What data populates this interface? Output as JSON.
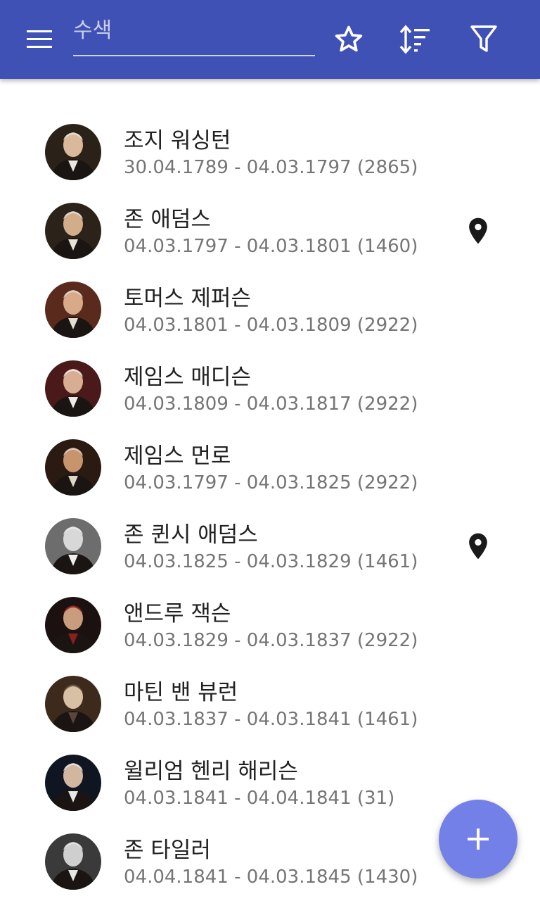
{
  "app_bar": {
    "search": {
      "placeholder": "수색",
      "value": ""
    },
    "icons": {
      "menu": "menu-icon",
      "favorites": "star-outline-icon",
      "sort": "sort-icon",
      "filter": "filter-icon"
    }
  },
  "presidents": [
    {
      "name": "조지 워싱턴",
      "dates": "30.04.1789 - 04.03.1797 (2865)",
      "pinned": false,
      "palette": [
        "#2a2118",
        "#d9b99a",
        "#ebe6df"
      ]
    },
    {
      "name": "존 애덤스",
      "dates": "04.03.1797 - 04.03.1801 (1460)",
      "pinned": true,
      "palette": [
        "#2b2219",
        "#d1ad8a",
        "#e8e3da"
      ]
    },
    {
      "name": "토머스 제퍼슨",
      "dates": "04.03.1801 - 04.03.1809 (2922)",
      "pinned": false,
      "palette": [
        "#5a2a1c",
        "#d8aa8a",
        "#e3ddd2"
      ]
    },
    {
      "name": "제임스 매디슨",
      "dates": "04.03.1809 - 04.03.1817 (2922)",
      "pinned": false,
      "palette": [
        "#4a1a1a",
        "#d7ae92",
        "#f0ece5"
      ]
    },
    {
      "name": "제임스 먼로",
      "dates": "04.03.1797 - 04.03.1825 (2922)",
      "pinned": false,
      "palette": [
        "#2a1a12",
        "#c8946e",
        "#e0d6c8"
      ]
    },
    {
      "name": "존 퀸시 애덤스",
      "dates": "04.03.1825 - 04.03.1829 (1461)",
      "pinned": true,
      "palette": [
        "#6d6d6d",
        "#d8d8d8",
        "#efefef"
      ]
    },
    {
      "name": "앤드루 잭슨",
      "dates": "04.03.1829 - 04.03.1837 (2922)",
      "pinned": false,
      "palette": [
        "#1b1110",
        "#c89c7c",
        "#8a1f1f"
      ]
    },
    {
      "name": "마틴 밴 뷰런",
      "dates": "04.03.1837 - 04.03.1841 (1461)",
      "pinned": false,
      "palette": [
        "#3e2a1c",
        "#d8c0a4",
        "#5a463a"
      ]
    },
    {
      "name": "윌리엄 헨리 해리슨",
      "dates": "04.03.1841 - 04.04.1841 (31)",
      "pinned": false,
      "palette": [
        "#0f1622",
        "#d2b6a0",
        "#e8e8e8"
      ]
    },
    {
      "name": "존 타일러",
      "dates": "04.04.1841 - 04.03.1845 (1430)",
      "pinned": false,
      "palette": [
        "#3a3a3a",
        "#cfcfcf",
        "#e6e6e6"
      ]
    }
  ],
  "fab": {
    "icon": "plus-icon"
  },
  "colors": {
    "primary": "#3f51b5",
    "fab": "#7380e8",
    "name_text": "#212121",
    "date_text": "#757575",
    "pin": "#1a1a1a"
  }
}
